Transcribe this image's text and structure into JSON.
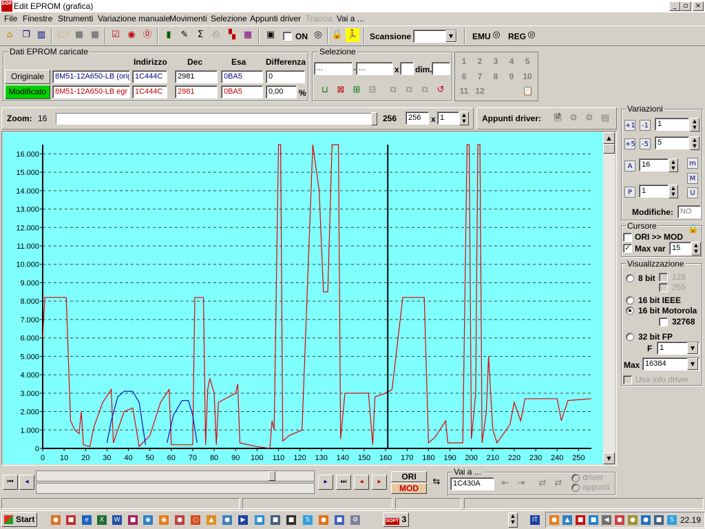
{
  "window": {
    "title": "Edit EPROM (grafica)",
    "icon_text": "SOFT"
  },
  "menu": [
    "File",
    "Finestre",
    "Strumenti",
    "Variazione manuale",
    "Movimenti",
    "Selezione",
    "Appunti driver",
    "Traccia",
    "Vai a ..."
  ],
  "toolbar": {
    "on_label": "ON",
    "scansione_label": "Scansione",
    "emu_label": "EMU",
    "reg_label": "REG"
  },
  "eprom": {
    "group_label": "Dati EPROM caricate",
    "headers": {
      "indirizzo": "Indirizzo",
      "dec": "Dec",
      "esa": "Esa",
      "differenza": "Differenza"
    },
    "originale": {
      "label": "Originale",
      "name": "8M51-12A650-LB (orig",
      "addr": "1C444C",
      "dec": "2981",
      "esa": "0BA5",
      "diff": "0"
    },
    "modificato": {
      "label": "Modificato",
      "name": "8M51-12A650-LB egr",
      "addr": "1C444C",
      "dec": "2981",
      "esa": "0BA5",
      "diff": "0,00",
      "unit": "%"
    }
  },
  "selezione": {
    "group_label": "Selezione",
    "from": "...",
    "to": "...",
    "x_label": "x",
    "dim_label": "dim.",
    "numbers": [
      "1",
      "2",
      "3",
      "4",
      "5",
      "6",
      "7",
      "8",
      "9",
      "10",
      "11",
      "12"
    ]
  },
  "zoom": {
    "label": "Zoom:",
    "min": "16",
    "max": "256",
    "value": "256",
    "x_label": "x",
    "mult": "1"
  },
  "appunti": {
    "label": "Appunti driver:"
  },
  "variazioni": {
    "group_label": "Variazioni",
    "v1": "1",
    "v2": "5",
    "v3": "16",
    "v4": "1",
    "modifiche_label": "Modifiche:",
    "modifiche_value": "NO"
  },
  "cursore": {
    "group_label": "Cursore",
    "ori_mod": "ORI >> MOD",
    "max_var_label": "Max var",
    "max_var_value": "15"
  },
  "visualizzazione": {
    "group_label": "Visualizzazione",
    "opt8": "8 bit",
    "opt128": "128",
    "opt255": "255",
    "opt16ieee": "16 bit IEEE",
    "opt16mot": "16 bit Motorola",
    "opt32768": "32768",
    "opt32fp": "32 bit FP",
    "f_label": "F",
    "f_value": "1",
    "max_label": "Max",
    "max_value": "16384",
    "usa_info": "Usa info driver"
  },
  "bottom": {
    "ori_label": "ORI",
    "mod_label": "MOD",
    "vai_label": "Vai a ...",
    "vai_value": "1C430A",
    "driver_label": "driver",
    "appunti_label": "appunti"
  },
  "taskbar": {
    "start_label": "Start",
    "clock": "22.19",
    "soft_label": "SOFT",
    "count_label": "3"
  },
  "colors": {
    "plot_bg": "#80ffff",
    "series_red": "#e00000",
    "series_blue": "#1010c0",
    "cursor": "#000000"
  },
  "chart_data": {
    "type": "line",
    "xlim": [
      0,
      256
    ],
    "ylim": [
      0,
      16500
    ],
    "x_ticks": [
      0,
      10,
      20,
      30,
      40,
      50,
      60,
      70,
      80,
      90,
      100,
      110,
      120,
      130,
      140,
      150,
      160,
      170,
      180,
      190,
      200,
      210,
      220,
      230,
      240,
      250
    ],
    "y_ticks": [
      0,
      1000,
      2000,
      3000,
      4000,
      5000,
      6000,
      7000,
      8000,
      9000,
      10000,
      11000,
      12000,
      13000,
      14000,
      15000,
      16000
    ],
    "y_tick_labels": [
      "0",
      "1.000",
      "2.000",
      "3.000",
      "4.000",
      "5.000",
      "6.000",
      "7.000",
      "8.000",
      "9.000",
      "10.000",
      "11.000",
      "12.000",
      "13.000",
      "14.000",
      "15.000",
      "16.000"
    ],
    "grid": true,
    "cursor_x": 161,
    "series": [
      {
        "color": "#e00000",
        "points": [
          [
            0,
            6000
          ],
          [
            1,
            8200
          ],
          [
            11,
            8200
          ],
          [
            13,
            1500
          ],
          [
            15,
            1000
          ],
          [
            17,
            800
          ],
          [
            18,
            2000
          ],
          [
            19,
            200
          ],
          [
            22,
            100
          ],
          [
            24,
            1200
          ],
          [
            28,
            2500
          ],
          [
            32,
            3200
          ],
          [
            33,
            300
          ],
          [
            35,
            1000
          ],
          [
            38,
            2000
          ],
          [
            42,
            2200
          ],
          [
            45,
            100
          ],
          [
            50,
            700
          ],
          [
            55,
            2500
          ],
          [
            59,
            3200
          ],
          [
            60,
            200
          ],
          [
            70,
            200
          ],
          [
            71,
            8200
          ],
          [
            75,
            8200
          ],
          [
            76,
            200
          ],
          [
            77,
            3200
          ],
          [
            78,
            3800
          ],
          [
            80,
            3000
          ],
          [
            81,
            200
          ],
          [
            82,
            2500
          ],
          [
            90,
            3000
          ],
          [
            91,
            3500
          ],
          [
            92,
            300
          ],
          [
            100,
            100
          ],
          [
            106,
            0
          ],
          [
            107,
            1500
          ],
          [
            108,
            1000
          ],
          [
            110,
            16500
          ],
          [
            111,
            16500
          ],
          [
            112,
            400
          ],
          [
            115,
            700
          ],
          [
            121,
            1000
          ],
          [
            126,
            16500
          ],
          [
            129,
            14000
          ],
          [
            131,
            8500
          ],
          [
            133,
            8500
          ],
          [
            135,
            16500
          ],
          [
            138,
            16500
          ],
          [
            139,
            500
          ],
          [
            141,
            3000
          ],
          [
            152,
            3000
          ],
          [
            154,
            200
          ],
          [
            155,
            2800
          ],
          [
            160,
            3000
          ],
          [
            163,
            3200
          ],
          [
            168,
            8200
          ],
          [
            178,
            8200
          ],
          [
            180,
            300
          ],
          [
            183,
            600
          ],
          [
            188,
            1500
          ],
          [
            189,
            300
          ],
          [
            196,
            300
          ],
          [
            198,
            16500
          ],
          [
            199,
            16500
          ],
          [
            200,
            500
          ],
          [
            202,
            3000
          ],
          [
            203,
            16500
          ],
          [
            204,
            16500
          ],
          [
            205,
            300
          ],
          [
            207,
            2000
          ],
          [
            208,
            5000
          ],
          [
            210,
            1000
          ],
          [
            212,
            300
          ],
          [
            218,
            1300
          ],
          [
            220,
            2500
          ],
          [
            223,
            1500
          ],
          [
            225,
            2700
          ],
          [
            240,
            2700
          ],
          [
            242,
            1500
          ],
          [
            245,
            2600
          ],
          [
            258,
            2700
          ]
        ]
      },
      {
        "color": "#1010c0",
        "points": [
          [
            30,
            300
          ],
          [
            32,
            1500
          ],
          [
            35,
            2800
          ],
          [
            38,
            3100
          ],
          [
            42,
            3100
          ],
          [
            45,
            2500
          ],
          [
            48,
            200
          ]
        ]
      },
      {
        "color": "#1010c0",
        "points": [
          [
            58,
            300
          ],
          [
            61,
            1800
          ],
          [
            65,
            2600
          ],
          [
            68,
            2600
          ],
          [
            70,
            1800
          ],
          [
            72,
            300
          ]
        ]
      }
    ]
  }
}
